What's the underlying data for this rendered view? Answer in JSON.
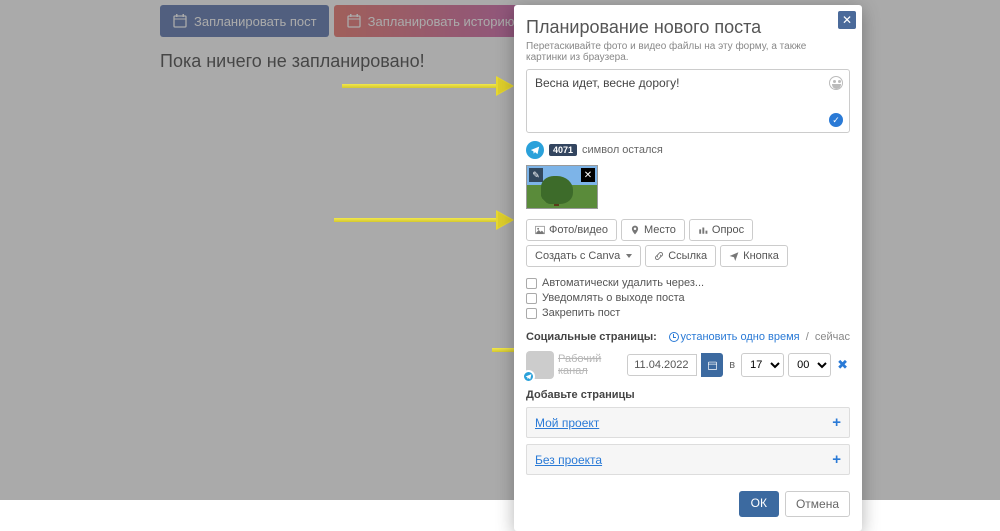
{
  "bg": {
    "btn_post": "Запланировать пост",
    "btn_story": "Запланировать историю",
    "empty": "Пока ничего не запланировано!"
  },
  "modal": {
    "title": "Планирование нового поста",
    "hint": "Перетаскивайте фото и видео файлы на эту форму, а также картинки из браузера.",
    "text": "Весна идет, весне дорогу!",
    "count": "4071",
    "remain": "символ остался",
    "btns": {
      "photo": "Фото/видео",
      "place": "Место",
      "poll": "Опрос",
      "canva": "Создать с Canva",
      "link": "Ссылка",
      "button": "Кнопка"
    },
    "checks": {
      "auto_del": "Автоматически удалить через...",
      "notify": "Уведомлять о выходе поста",
      "pin": "Закрепить пост"
    },
    "social_label": "Социальные страницы:",
    "set_time": "установить одно время",
    "now": "сейчас",
    "channel": "Рабочий канал",
    "date": "11.04.2022",
    "at": "в",
    "hour": "17",
    "minute": "00",
    "add_pages": "Добавьте страницы",
    "proj1": "Мой проект",
    "proj2": "Без проекта",
    "ok": "ОК",
    "cancel": "Отмена"
  }
}
